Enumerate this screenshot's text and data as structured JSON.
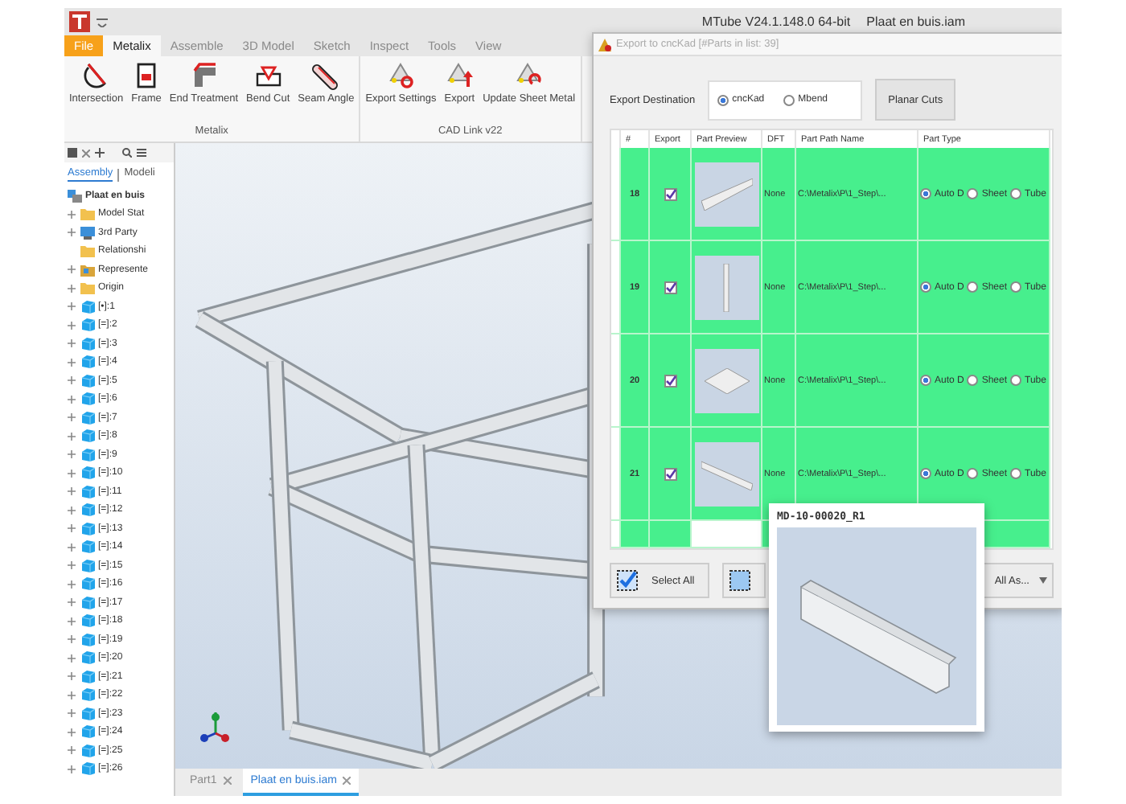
{
  "window": {
    "product": "MTube V24.1.148.0 64-bit",
    "document": "Plaat en buis.iam"
  },
  "ribbon": {
    "tabs": [
      {
        "label": "File",
        "kind": "file"
      },
      {
        "label": "Metalix",
        "kind": "tab",
        "selected": true
      },
      {
        "label": "Assemble",
        "kind": "tab",
        "selected": false
      },
      {
        "label": "3D Model",
        "kind": "tab",
        "selected": false
      },
      {
        "label": "Sketch",
        "kind": "tab",
        "selected": false
      },
      {
        "label": "Inspect",
        "kind": "tab",
        "selected": false
      },
      {
        "label": "Tools",
        "kind": "tab",
        "selected": false
      },
      {
        "label": "View",
        "kind": "tab",
        "selected": false
      }
    ],
    "groups": [
      {
        "label": "Metalix",
        "buttons": [
          {
            "label": "Intersection",
            "kind": "intersection"
          },
          {
            "label": "Frame",
            "kind": "frame"
          },
          {
            "label": "End Treatment",
            "kind": "end"
          },
          {
            "label": "Bend Cut",
            "kind": "bend"
          },
          {
            "label": "Seam Angle",
            "kind": "seam"
          }
        ]
      },
      {
        "label": "CAD Link v22",
        "buttons": [
          {
            "label": "Export Settings",
            "kind": "settings"
          },
          {
            "label": "Export",
            "kind": "export"
          },
          {
            "label": "Update Sheet Metal",
            "kind": "update"
          }
        ]
      }
    ]
  },
  "browser": {
    "tabs": [
      {
        "label": "Assembly",
        "selected": true
      },
      {
        "label": "Modeli",
        "selected": false
      }
    ],
    "tree": {
      "label": "Plaat en buis",
      "children": [
        {
          "label": "Model Stat",
          "kind": "folder",
          "expanded": false
        },
        {
          "label": "3rd Party",
          "kind": "link",
          "expanded": false
        },
        {
          "label": "Relationshi",
          "kind": "folder"
        },
        {
          "label": "Represente",
          "kind": "representations",
          "expanded": false
        },
        {
          "label": "Origin",
          "kind": "folder",
          "expanded": false
        },
        {
          "label": "[•]:1",
          "kind": "part",
          "expanded": false
        },
        {
          "label": "[=]:2",
          "kind": "part",
          "expanded": false
        },
        {
          "label": "[=]:3",
          "kind": "part",
          "expanded": false
        },
        {
          "label": "[=]:4",
          "kind": "part",
          "expanded": false
        },
        {
          "label": "[=]:5",
          "kind": "part",
          "expanded": false
        },
        {
          "label": "[=]:6",
          "kind": "part",
          "expanded": false
        },
        {
          "label": "[=]:7",
          "kind": "part",
          "expanded": false
        },
        {
          "label": "[=]:8",
          "kind": "part",
          "expanded": false
        },
        {
          "label": "[=]:9",
          "kind": "part",
          "expanded": false
        },
        {
          "label": "[=]:10",
          "kind": "part",
          "expanded": false
        },
        {
          "label": "[=]:11",
          "kind": "part",
          "expanded": false
        },
        {
          "label": "[=]:12",
          "kind": "part",
          "expanded": false
        },
        {
          "label": "[=]:13",
          "kind": "part",
          "expanded": false
        },
        {
          "label": "[=]:14",
          "kind": "part",
          "expanded": false
        },
        {
          "label": "[=]:15",
          "kind": "part",
          "expanded": false
        },
        {
          "label": "[=]:16",
          "kind": "part",
          "expanded": false
        },
        {
          "label": "[=]:17",
          "kind": "part",
          "expanded": false
        },
        {
          "label": "[=]:18",
          "kind": "part",
          "expanded": false
        },
        {
          "label": "[=]:19",
          "kind": "part",
          "expanded": false
        },
        {
          "label": "[=]:20",
          "kind": "part",
          "expanded": false
        },
        {
          "label": "[=]:21",
          "kind": "part",
          "expanded": false
        },
        {
          "label": "[=]:22",
          "kind": "part",
          "expanded": false
        },
        {
          "label": "[=]:23",
          "kind": "part",
          "expanded": false
        },
        {
          "label": "[=]:24",
          "kind": "part",
          "expanded": false
        },
        {
          "label": "[=]:25",
          "kind": "part",
          "expanded": false
        },
        {
          "label": "[=]:26",
          "kind": "part",
          "expanded": false
        }
      ]
    }
  },
  "document_tabs": [
    {
      "label": "Part1",
      "selected": false
    },
    {
      "label": "Plaat en buis.iam",
      "selected": true
    }
  ],
  "dialog": {
    "title": "Export to cncKad [#Parts in list: 39]",
    "destination": {
      "label": "Export Destination",
      "options": [
        {
          "label": "cncKad",
          "selected": true
        },
        {
          "label": "Mbend",
          "selected": false
        }
      ]
    },
    "planar_button": "Planar Cuts",
    "columns": [
      "#",
      "Export",
      "Part Preview",
      "DFT",
      "Part Path Name",
      "Part Type"
    ],
    "rows": [
      {
        "number": "18",
        "export": true,
        "dft": "None",
        "path": "C:\\Metalix\\P\\1_Step\\...",
        "part_type": [
          {
            "label": "Auto D",
            "selected": true
          },
          {
            "label": "Sheet",
            "selected": false
          },
          {
            "label": "Tube",
            "selected": false
          }
        ]
      },
      {
        "number": "19",
        "export": true,
        "dft": "None",
        "path": "C:\\Metalix\\P\\1_Step\\...",
        "part_type": [
          {
            "label": "Auto D",
            "selected": true
          },
          {
            "label": "Sheet",
            "selected": false
          },
          {
            "label": "Tube",
            "selected": false
          }
        ]
      },
      {
        "number": "20",
        "export": true,
        "dft": "None",
        "path": "C:\\Metalix\\P\\1_Step\\...",
        "part_type": [
          {
            "label": "Auto D",
            "selected": true
          },
          {
            "label": "Sheet",
            "selected": false
          },
          {
            "label": "Tube",
            "selected": false
          }
        ]
      },
      {
        "number": "21",
        "export": true,
        "dft": "None",
        "path": "C:\\Metalix\\P\\1_Step\\...",
        "part_type": [
          {
            "label": "Auto D",
            "selected": true
          },
          {
            "label": "Sheet",
            "selected": false
          },
          {
            "label": "Tube",
            "selected": false
          }
        ]
      }
    ],
    "select_all": "Select All",
    "save_dropdown": "All As..."
  },
  "preview_popup": {
    "title": "MD-10-00020_R1"
  }
}
